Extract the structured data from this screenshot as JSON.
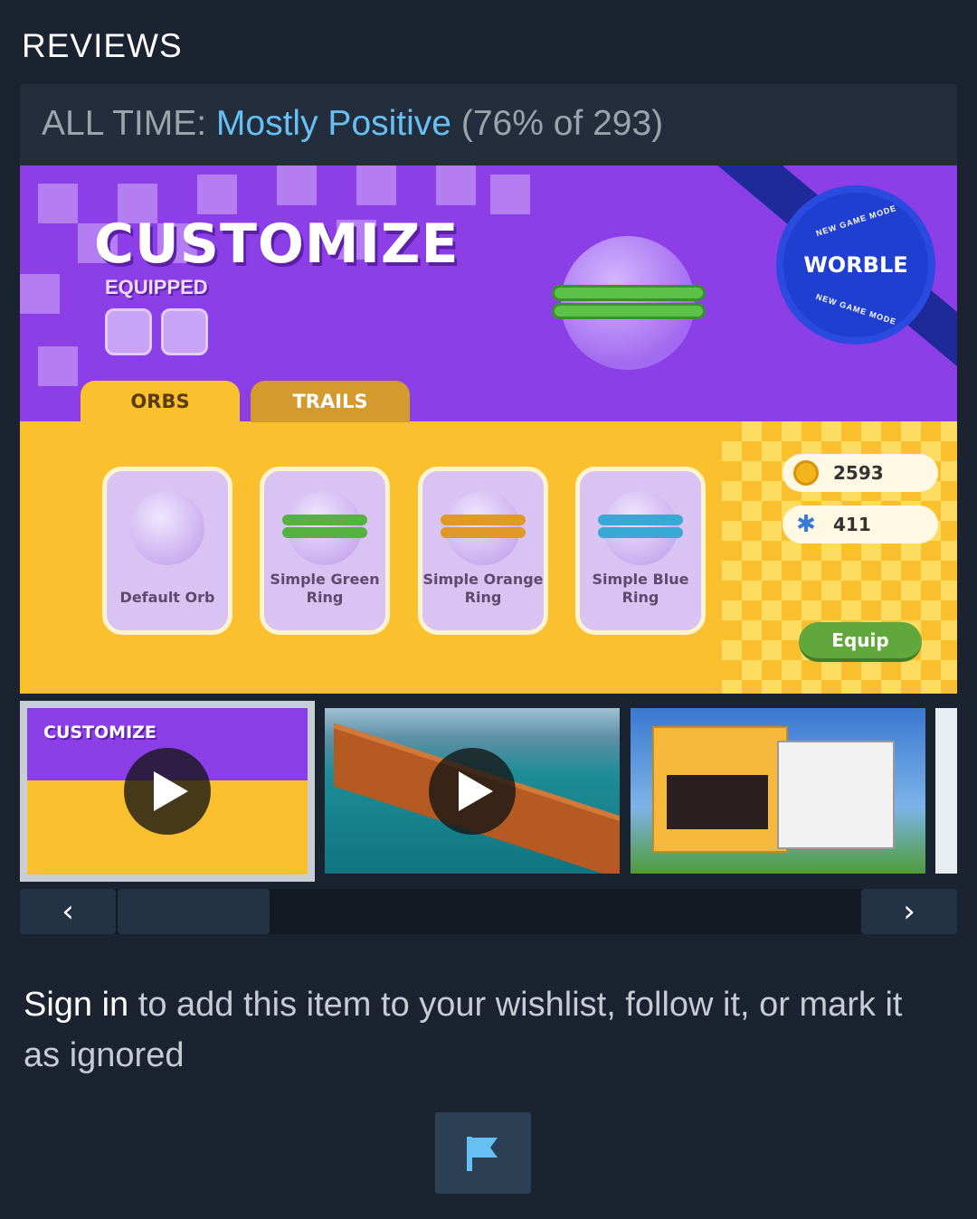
{
  "section": {
    "title": "REVIEWS"
  },
  "reviews": {
    "label": "ALL TIME:",
    "rating": "Mostly Positive",
    "count": "(76% of 293)"
  },
  "hero": {
    "title": "CUSTOMIZE",
    "equipped": "EQUIPPED",
    "badge_name": "WORBLE",
    "badge_arc": "NEW GAME MODE",
    "tabs": [
      {
        "label": "ORBS"
      },
      {
        "label": "TRAILS"
      }
    ],
    "cards": [
      {
        "name": "Default Orb",
        "ring_color": ""
      },
      {
        "name": "Simple Green Ring",
        "ring_color": "#5cc247"
      },
      {
        "name": "Simple Orange Ring",
        "ring_color": "#f4a52c"
      },
      {
        "name": "Simple Blue Ring",
        "ring_color": "#3db8e6"
      }
    ],
    "coins": "2593",
    "gems": "411",
    "equip_label": "Equip"
  },
  "thumbnails": [
    {
      "title": "CUSTOMIZE",
      "type": "video"
    },
    {
      "title": "",
      "type": "video"
    },
    {
      "title": "",
      "type": "image"
    },
    {
      "title": "",
      "type": "image"
    }
  ],
  "nav": {
    "prev": "‹",
    "next": "›"
  },
  "signin": {
    "link": "Sign in",
    "text": " to add this item to your wishlist, follow it, or mark it as ignored"
  },
  "icons": {
    "flag": "flag-icon"
  },
  "colors": {
    "accent": "#66c0f4",
    "background": "#1b2230",
    "panel": "#232d3c"
  }
}
